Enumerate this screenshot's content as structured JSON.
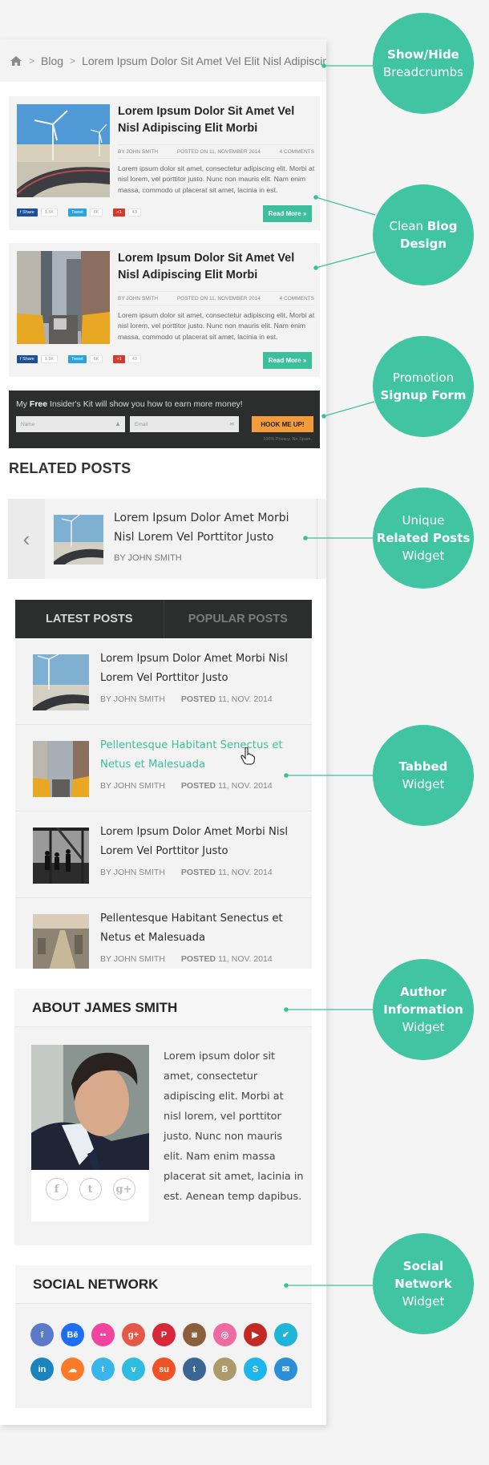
{
  "colors": {
    "accent": "#3dbf9c",
    "callout": "#40c4a2",
    "dark_bar": "#2c2e2e",
    "orange_button": "#f49b3a"
  },
  "breadcrumbs": {
    "home_icon": "home-icon",
    "items": [
      "Blog",
      "Lorem Ipsum Dolor Sit Amet Vel Elit Nisl Adipiscin"
    ]
  },
  "blog_posts": [
    {
      "title": "Lorem Ipsum Dolor Sit Amet Vel Nisl Adipiscing Elit Morbi",
      "author": "By John Smith",
      "posted": "Posted on 11, November 2014",
      "comments": "4 Comments",
      "excerpt": "Lorem ipsum dolor sit amet, consectetur adipiscing elit. Morbi at nisl lorem, vel porttitor justo. Nunc non mauris elit. Nam enim massa, commodo ut placerat sit amet, lacinia in est.",
      "image": "wind-turbines-road",
      "share": {
        "facebook_label": "f Share",
        "facebook_count": "1.5K",
        "twitter_label": "Tweet",
        "twitter_count": "6K",
        "gplus_label": "+1",
        "gplus_count": "43"
      },
      "read_more": "Read More »"
    },
    {
      "title": "Lorem Ipsum Dolor Sit Amet Vel Nisl Adipiscing Elit Morbi",
      "author": "By John Smith",
      "posted": "Posted on 11, November 2014",
      "comments": "4 Comments",
      "excerpt": "Lorem ipsum dolor sit amet, consectetur adipiscing elit. Morbi at nisl lorem, vel porttitor justo. Nunc non mauris elit. Nam enim massa, commodo ut placerat sit amet, lacinia in est.",
      "image": "city-taxis",
      "share": {
        "facebook_label": "f Share",
        "facebook_count": "1.5K",
        "twitter_label": "Tweet",
        "twitter_count": "6K",
        "gplus_label": "+1",
        "gplus_count": "43"
      },
      "read_more": "Read More »"
    }
  ],
  "signup": {
    "headline_pre": "My ",
    "headline_bold": "Free",
    "headline_post": " Insider's Kit will show you how to earn more money!",
    "name_placeholder": "Name",
    "email_placeholder": "Email",
    "submit": "HOOK ME UP!",
    "privacy": "100% Privacy. No Spam."
  },
  "related": {
    "heading": "RELATED POSTS",
    "title": "Lorem Ipsum Dolor Amet Morbi Nisl Lorem Vel Porttitor Justo",
    "author": "BY JOHN SMITH",
    "prev_icon": "‹"
  },
  "tabbed": {
    "tabs": [
      "LATEST POSTS",
      "POPULAR POSTS"
    ],
    "active_tab": 0,
    "items": [
      {
        "title": "Lorem Ipsum Dolor Amet Morbi Nisl Lorem Vel Porttitor Justo",
        "author": "BY JOHN SMITH",
        "posted_label": "POSTED",
        "date": "11, NOV. 2014",
        "hover": false
      },
      {
        "title": "Pellentesque Habitant Senectus et Netus et Malesuada",
        "author": "BY JOHN SMITH",
        "posted_label": "POSTED",
        "date": "11, NOV. 2014",
        "hover": true
      },
      {
        "title": "Lorem Ipsum Dolor Amet Morbi Nisl Lorem Vel Porttitor Justo",
        "author": "BY JOHN SMITH",
        "posted_label": "POSTED",
        "date": "11, NOV. 2014",
        "hover": false
      },
      {
        "title": "Pellentesque Habitant Senectus et Netus et Malesuada",
        "author": "BY JOHN SMITH",
        "posted_label": "POSTED",
        "date": "11, NOV. 2014",
        "hover": false
      }
    ]
  },
  "author": {
    "heading": "ABOUT JAMES SMITH",
    "bio": "Lorem ipsum dolor sit amet, consectetur adipiscing elit. Morbi at nisl lorem, vel porttitor justo. Nunc non mauris elit. Nam enim massa placerat sit amet, lacinia in est. Aenean temp dapibus.",
    "socials": [
      {
        "name": "facebook",
        "glyph": "f"
      },
      {
        "name": "twitter",
        "glyph": "t"
      },
      {
        "name": "google-plus",
        "glyph": "g+"
      }
    ]
  },
  "social_network": {
    "heading": "SOCIAL NETWORK",
    "icons": [
      {
        "name": "facebook",
        "glyph": "f",
        "color": "#5b7ac9"
      },
      {
        "name": "behance",
        "glyph": "Bē",
        "color": "#1d6ef2"
      },
      {
        "name": "flickr",
        "glyph": "••",
        "color": "#f2449e"
      },
      {
        "name": "google-plus",
        "glyph": "g+",
        "color": "#e25a47"
      },
      {
        "name": "pinterest",
        "glyph": "P",
        "color": "#d7283a"
      },
      {
        "name": "instagram",
        "glyph": "◙",
        "color": "#8b5e3c"
      },
      {
        "name": "dribbble",
        "glyph": "◎",
        "color": "#ef6aa0"
      },
      {
        "name": "youtube",
        "glyph": "▶",
        "color": "#c42a24"
      },
      {
        "name": "foursquare",
        "glyph": "✔",
        "color": "#1fb4d8"
      },
      {
        "name": "linkedin",
        "glyph": "in",
        "color": "#1b84bd"
      },
      {
        "name": "soundcloud",
        "glyph": "☁",
        "color": "#fa7a2a"
      },
      {
        "name": "twitter",
        "glyph": "t",
        "color": "#38b5ea"
      },
      {
        "name": "vimeo",
        "glyph": "v",
        "color": "#2ebde0"
      },
      {
        "name": "stumbleupon",
        "glyph": "su",
        "color": "#ef5225"
      },
      {
        "name": "tumblr",
        "glyph": "t",
        "color": "#3b6592"
      },
      {
        "name": "blogger",
        "glyph": "B",
        "color": "#ac9a6a"
      },
      {
        "name": "skype",
        "glyph": "S",
        "color": "#1bb6ec"
      },
      {
        "name": "email",
        "glyph": "✉",
        "color": "#2b8fd8"
      }
    ]
  },
  "callouts": [
    {
      "bold": "Show/Hide",
      "normal": "Breadcrumbs",
      "order": "bold-first"
    },
    {
      "normal": "Clean",
      "bold": "Blog Design",
      "order": "normal-first"
    },
    {
      "normal": "Promotion",
      "bold": "Signup Form",
      "order": "normal-first"
    },
    {
      "pre": "Unique",
      "bold": "Related Posts",
      "post": "Widget"
    },
    {
      "bold": "Tabbed",
      "normal": "Widget",
      "order": "bold-first"
    },
    {
      "bold": "Author Information",
      "normal": "Widget",
      "order": "bold-first"
    },
    {
      "bold": "Social Network",
      "normal": "Widget",
      "order": "bold-first"
    }
  ]
}
